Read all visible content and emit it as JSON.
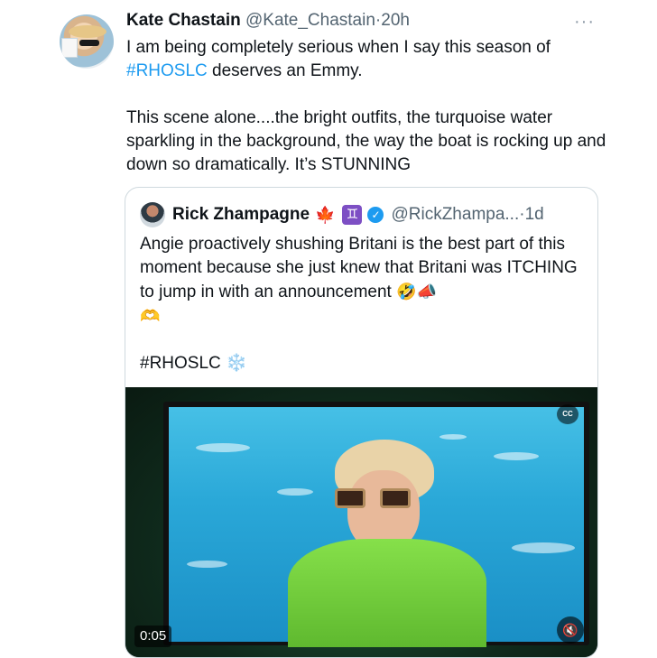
{
  "tweet": {
    "author_name": "Kate Chastain",
    "author_handle": "@Kate_Chastain",
    "dot": "·",
    "time": "20h",
    "more_icon": "more-horizontal-icon",
    "text_line1_pre": "I am being completely serious when I say this season of",
    "hashtag": "#RHOSLC",
    "text_line2_post": " deserves an Emmy.",
    "paragraph2": "This scene alone....the bright outfits, the turquoise water sparkling in the background, the way the boat is rocking up and down so dramatically. It’s STUNNING"
  },
  "quote": {
    "author_name": "Rick Zhampagne",
    "leaf_emoji": "🍁",
    "gemini_emoji": "♊",
    "verified_icon": "verified-badge-icon",
    "author_handle": "@RickZhampa...",
    "dot": "·",
    "time": "1d",
    "text": "Angie proactively shushing Britani is the best part of this moment because she just knew that Britani was ITCHING to jump in with an announcement",
    "emojis_inline": "🤣📣",
    "emoji_line": "🫶",
    "hashtag_line": "#RHOSLC",
    "snow_emoji": "❄️"
  },
  "video": {
    "cc_label": "CC",
    "duration": "0:05",
    "mute_icon": "volume-muted-icon"
  }
}
